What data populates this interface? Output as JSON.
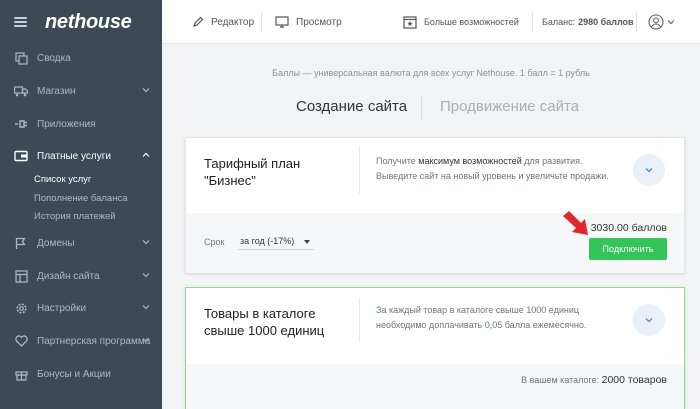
{
  "sidebar": {
    "logo": "nethouse",
    "items": [
      {
        "label": "Сводка",
        "icon": "copy-icon",
        "chevron": false
      },
      {
        "label": "Магазин",
        "icon": "truck-icon",
        "chevron": true
      },
      {
        "label": "Приложения",
        "icon": "plug-icon",
        "chevron": false
      },
      {
        "label": "Платные услуги",
        "icon": "wallet-icon",
        "chevron": true,
        "active": true
      },
      {
        "label": "Домены",
        "icon": "flag-icon",
        "chevron": true
      },
      {
        "label": "Дизайн сайта",
        "icon": "layout-icon",
        "chevron": true
      },
      {
        "label": "Настройки",
        "icon": "gear-icon",
        "chevron": true
      },
      {
        "label": "Партнерская программа",
        "icon": "heart-icon",
        "chevron": true
      },
      {
        "label": "Бонусы и Акции",
        "icon": "gift-icon",
        "chevron": false
      }
    ],
    "subitems": [
      {
        "label": "Список услуг",
        "active": true
      },
      {
        "label": "Пополнение баланса",
        "active": false
      },
      {
        "label": "История платежей",
        "active": false
      }
    ]
  },
  "topbar": {
    "editor": "Редактор",
    "preview": "Просмотр",
    "more": "Больше возможностей",
    "balance_label": "Баланс:",
    "balance_value": "2980 баллов"
  },
  "content": {
    "info": "Баллы — универсальная валюта для всех услуг Nethouse. 1 балл = 1 рубль",
    "tabs": [
      "Создание сайта",
      "Продвижение сайта"
    ],
    "card1": {
      "title_line1": "Тарифный план",
      "title_line2": "\"Бизнес\"",
      "desc_pre": "Получите ",
      "desc_bold": "максимум возможностей",
      "desc_post": " для развития.",
      "desc_line2": "Выведите сайт на новый уровень и увеличьте продажи.",
      "term_label": "Срок",
      "term_value": "за год (-17%)",
      "price": "3030.00 баллов",
      "button": "Подключить"
    },
    "card2": {
      "title_line1": "Товары в каталоге",
      "title_line2": "свыше 1000 единиц",
      "desc_line1": "За каждый товар в каталоге свыше 1000 единиц",
      "desc_line2": "необходимо доплачивать 0,05 балла ежемесячно.",
      "catalog_label": "В вашем каталоге:",
      "catalog_value": "2000 товаров"
    }
  },
  "colors": {
    "sidebar_bg": "#3d4a55",
    "accent_green": "#35c45a",
    "arrow_red": "#e3262b"
  }
}
